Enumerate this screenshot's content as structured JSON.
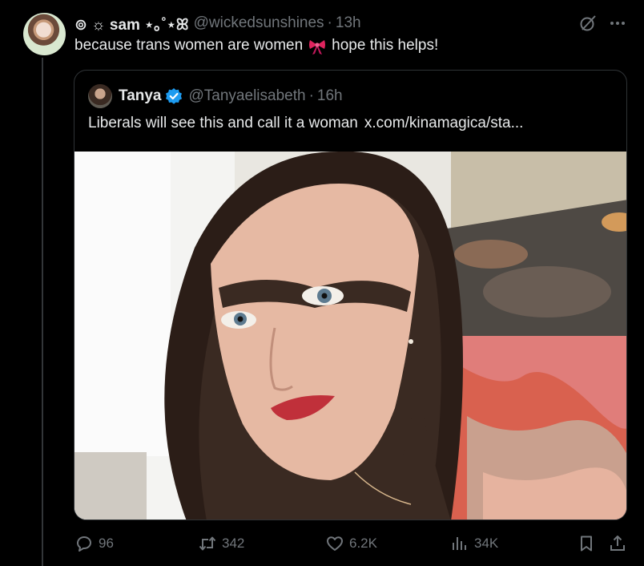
{
  "tweet": {
    "display_name": "⊚ ☼ sam ⋆｡˚⋆ꕤ",
    "handle": "@wickedsunshines",
    "separator": "·",
    "time": "13h",
    "text_before": "because trans women are women",
    "text_after": "hope this helps!",
    "emoji": "ribbon-bow"
  },
  "quote": {
    "name": "Tanya",
    "verified": true,
    "handle": "@Tanyaelisabeth",
    "separator": "·",
    "time": "16h",
    "text": "Liberals will see this and call it a woman",
    "link": "x.com/kinamagica/sta..."
  },
  "actions": {
    "replies": "96",
    "retweets": "342",
    "likes": "6.2K",
    "views": "34K"
  },
  "icons": {
    "grok": "grok-icon",
    "more": "more-icon",
    "reply": "reply-icon",
    "retweet": "retweet-icon",
    "like": "heart-icon",
    "views": "views-icon",
    "bookmark": "bookmark-icon",
    "share": "share-icon"
  },
  "colors": {
    "background": "#000000",
    "text": "#e7e9ea",
    "muted": "#71767b",
    "border": "#2f3336",
    "verified": "#1d9bf0"
  }
}
